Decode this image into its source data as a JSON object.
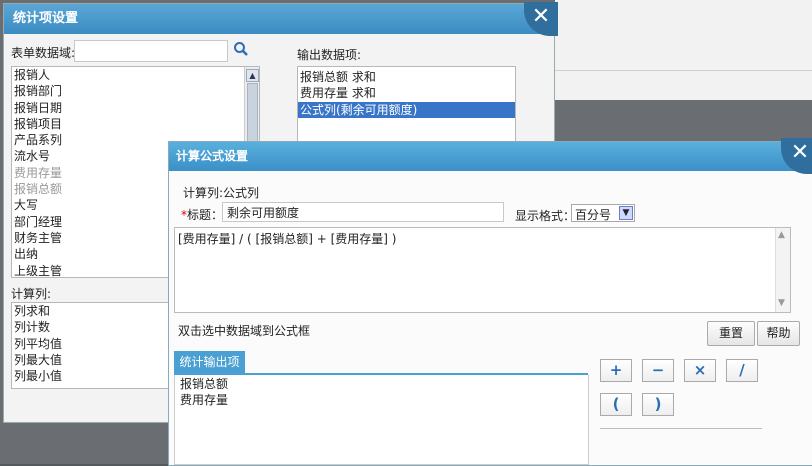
{
  "dialog1": {
    "title": "统计项设置",
    "close": "✕",
    "form_field_label": "表单数据域:",
    "output_label": "输出数据项:",
    "fields": [
      {
        "label": "报销人",
        "dim": false
      },
      {
        "label": "报销部门",
        "dim": false
      },
      {
        "label": "报销日期",
        "dim": false
      },
      {
        "label": "报销项目",
        "dim": false
      },
      {
        "label": "产品系列",
        "dim": false
      },
      {
        "label": "流水号",
        "dim": false
      },
      {
        "label": "费用存量",
        "dim": true
      },
      {
        "label": "报销总额",
        "dim": true
      },
      {
        "label": "大写",
        "dim": false
      },
      {
        "label": "部门经理",
        "dim": false
      },
      {
        "label": "财务主管",
        "dim": false
      },
      {
        "label": "出纳",
        "dim": false
      },
      {
        "label": "上级主管",
        "dim": false
      }
    ],
    "outputs": [
      {
        "label": "报销总额 求和",
        "selected": false
      },
      {
        "label": "费用存量 求和",
        "selected": false
      },
      {
        "label": "公式列(剩余可用额度)",
        "selected": true
      }
    ],
    "calc_column_label": "计算列:",
    "calc_columns": [
      "列求和",
      "列计数",
      "列平均值",
      "列最大值",
      "列最小值"
    ]
  },
  "dialog2": {
    "title": "计算公式设置",
    "close": "✕",
    "calc_column_info": "计算列:公式列",
    "required_mark": "*",
    "title_label": "标题：",
    "title_value": "剩余可用额度",
    "display_format_label": "显示格式：",
    "display_format_value": "百分号",
    "formula": "[费用存量] / ( [报销总额] + [费用存量] )",
    "hint": "双击选中数据域到公式框",
    "reset_button": "重置",
    "help_button": "帮助",
    "tab_label": "统计输出项",
    "stat_items": [
      "报销总额",
      "费用存量"
    ],
    "ops": {
      "plus": "+",
      "minus": "−",
      "times": "×",
      "divide": "/",
      "lparen": "(",
      "rparen": ")"
    }
  }
}
